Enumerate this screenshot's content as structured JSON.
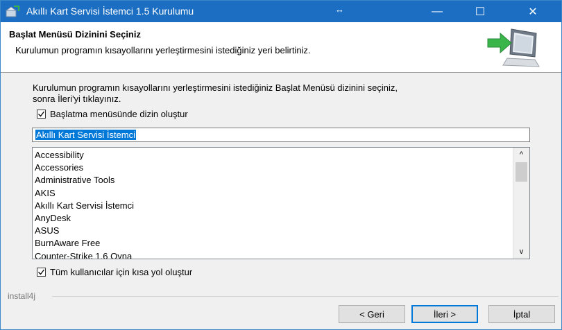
{
  "window": {
    "title": "Akıllı Kart Servisi İstemci 1.5 Kurulumu",
    "resize_glyph": "↔",
    "minimize_glyph": "—",
    "maximize_glyph": "☐",
    "close_glyph": "✕"
  },
  "header": {
    "title": "Başlat Menüsü Dizinini Seçiniz",
    "subtitle": "Kurulumun programın kısayollarını yerleştirmesini istediğiniz yeri belirtiniz."
  },
  "description": {
    "line1": "Kurulumun programın kısayollarını yerleştirmesini istediğiniz Başlat Menüsü dizinini seçiniz,",
    "line2": "sonra İleri'yi tıklayınız."
  },
  "create_folder_checkbox": {
    "label": "Başlatma menüsünde dizin oluştur",
    "checked": true
  },
  "folder_name_input": {
    "value": "Akıllı Kart Servisi İstemci"
  },
  "folder_list": {
    "items": [
      "Accessibility",
      "Accessories",
      "Administrative Tools",
      "AKIS",
      "Akıllı Kart Servisi İstemci",
      "AnyDesk",
      "ASUS",
      "BurnAware Free",
      "Counter-Strike 1.6 Oyna"
    ],
    "scroll_up_glyph": "^",
    "scroll_down_glyph": "v"
  },
  "all_users_checkbox": {
    "label": "Tüm kullanıcılar için kısa yol oluştur",
    "checked": true
  },
  "footer": {
    "brand": "install4j",
    "back_label": "< Geri",
    "next_label": "İleri >",
    "cancel_label": "İptal"
  },
  "colors": {
    "titlebar": "#1b6ec2",
    "selection": "#0078d7",
    "accent_arrow": "#3ab54a"
  }
}
